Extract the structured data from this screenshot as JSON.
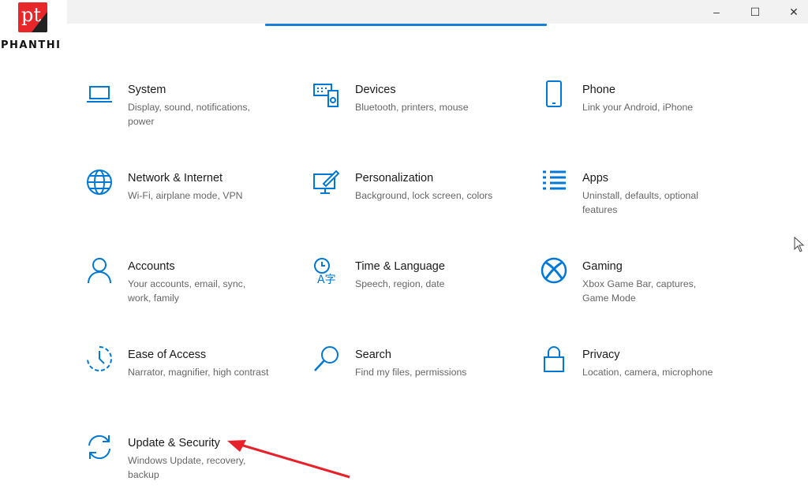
{
  "logo": {
    "text": "pt",
    "brand": "PHANTHI"
  },
  "window": {
    "minimize": "–",
    "maximize": "☐",
    "close": "✕"
  },
  "accent": "#0078d7",
  "annotation_color": "#e8202a",
  "tiles": [
    {
      "title": "System",
      "subtitle": "Display, sound, notifications, power",
      "icon": "laptop-icon"
    },
    {
      "title": "Devices",
      "subtitle": "Bluetooth, printers, mouse",
      "icon": "keyboard-speaker-icon"
    },
    {
      "title": "Phone",
      "subtitle": "Link your Android, iPhone",
      "icon": "phone-icon"
    },
    {
      "title": "Network & Internet",
      "subtitle": "Wi-Fi, airplane mode, VPN",
      "icon": "globe-icon"
    },
    {
      "title": "Personalization",
      "subtitle": "Background, lock screen, colors",
      "icon": "paint-icon"
    },
    {
      "title": "Apps",
      "subtitle": "Uninstall, defaults, optional features",
      "icon": "apps-list-icon"
    },
    {
      "title": "Accounts",
      "subtitle": "Your accounts, email, sync, work, family",
      "icon": "person-icon"
    },
    {
      "title": "Time & Language",
      "subtitle": "Speech, region, date",
      "icon": "time-language-icon"
    },
    {
      "title": "Gaming",
      "subtitle": "Xbox Game Bar, captures, Game Mode",
      "icon": "xbox-icon"
    },
    {
      "title": "Ease of Access",
      "subtitle": "Narrator, magnifier, high contrast",
      "icon": "ease-of-access-icon"
    },
    {
      "title": "Search",
      "subtitle": "Find my files, permissions",
      "icon": "search-icon"
    },
    {
      "title": "Privacy",
      "subtitle": "Location, camera, microphone",
      "icon": "lock-icon"
    },
    {
      "title": "Update & Security",
      "subtitle": "Windows Update, recovery, backup",
      "icon": "sync-icon"
    }
  ]
}
